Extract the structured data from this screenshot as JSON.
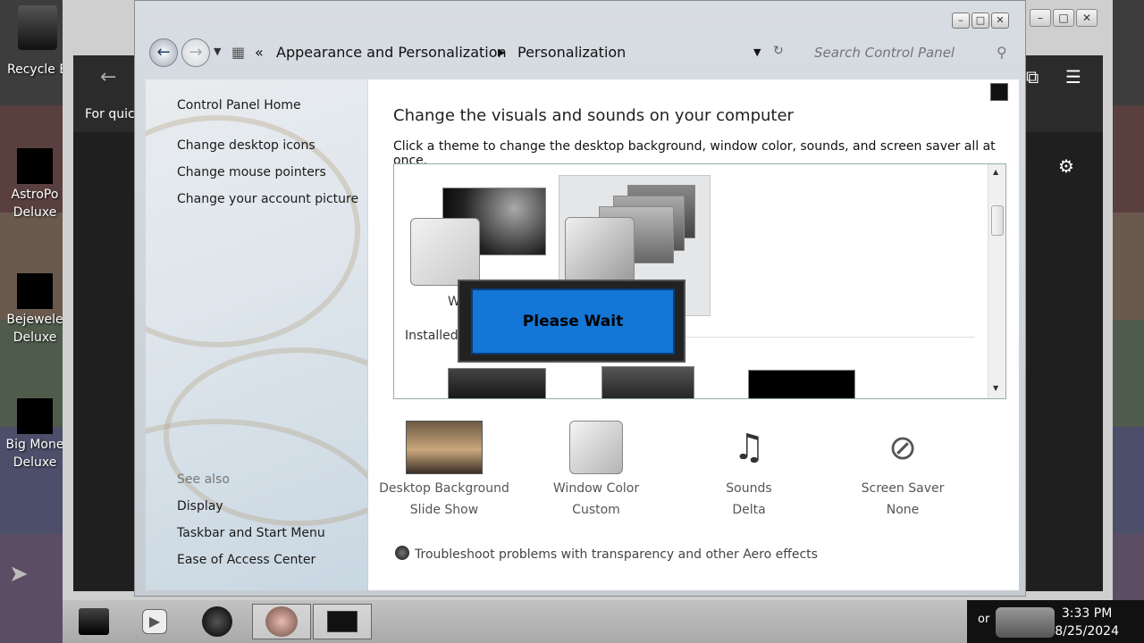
{
  "desktop": {
    "icons": [
      {
        "label_1": "Recycle B"
      },
      {
        "label_1": "AstroPo",
        "label_2": "Deluxe"
      },
      {
        "label_1": "Bejewele",
        "label_2": "Deluxe"
      },
      {
        "label_1": "Big Mone",
        "label_2": "Deluxe"
      }
    ]
  },
  "bg_window": {
    "quick_text": "For quic"
  },
  "window": {
    "breadcrumb_separator": "«",
    "breadcrumb": [
      "Appearance and Personalization",
      "Personalization"
    ],
    "search_placeholder": "Search Control Panel"
  },
  "left_panel": {
    "home": "Control Panel Home",
    "links": [
      "Change desktop icons",
      "Change mouse pointers",
      "Change your account picture"
    ],
    "see_also_label": "See also",
    "see_also": [
      "Display",
      "Taskbar and Start Menu",
      "Ease of Access Center"
    ]
  },
  "content": {
    "heading": "Change the visuals and sounds on your computer",
    "subtext": "Click a theme to change the desktop background, window color, sounds, and screen saver all at once.",
    "theme_label_partial": "W",
    "installed_label": "Installed",
    "settings": [
      {
        "title": "Desktop Background",
        "value": "Slide Show"
      },
      {
        "title": "Window Color",
        "value": "Custom"
      },
      {
        "title": "Sounds",
        "value": "Delta"
      },
      {
        "title": "Screen Saver",
        "value": "None"
      }
    ],
    "troubleshoot": "Troubleshoot problems with transparency and other Aero effects"
  },
  "dialog": {
    "text": "Please Wait"
  },
  "taskbar": {
    "time": "3:33 PM",
    "date": "8/25/2024",
    "tray_partial": "or"
  }
}
